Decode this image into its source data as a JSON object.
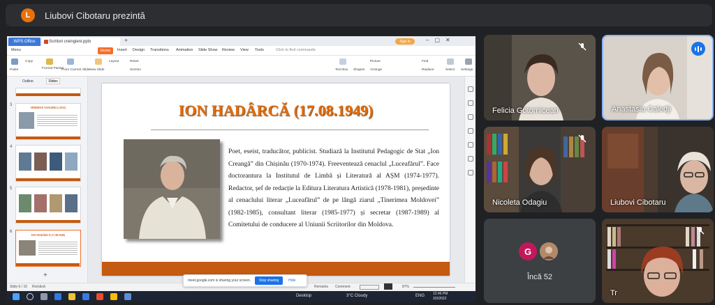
{
  "presenter": {
    "avatar_initial": "L",
    "label": "Liubovi Cibotaru prezintă"
  },
  "wps": {
    "office_tab": "WPS Office",
    "file_tab": "Scriitori creingieni.pptx",
    "sign_in": "Sign in",
    "menu": [
      "Menu",
      "Home",
      "Insert",
      "Design",
      "Transitions",
      "Animation",
      "Slide Show",
      "Review",
      "View",
      "Tools",
      "Click to find commands"
    ],
    "ribbon": [
      "Paste",
      "Copy",
      "Format Painter",
      "From Current Slide",
      "New Slide",
      "Layout",
      "Reset",
      "Section",
      "Text Box",
      "Shapes",
      "Picture",
      "Arrange",
      "Find",
      "Replace",
      "Select",
      "Settings"
    ],
    "pane_tabs": [
      "Outline",
      "Slides"
    ],
    "thumbs": [
      {
        "num": "3",
        "title": "SPIRIDON VANGHELI (1932)"
      },
      {
        "num": "4",
        "title": ""
      },
      {
        "num": "5",
        "title": ""
      },
      {
        "num": "6",
        "title": "ION HADÂRCĂ (17.08.1949)"
      }
    ],
    "status_left": "Slide 6 / 16",
    "status_lang": "Română",
    "status_right": [
      "Remarks",
      "Comment",
      "87%"
    ],
    "share_toast": {
      "text": "meet.google.com is sharing your screen.",
      "stop": "Stop sharing",
      "hide": "Hide"
    },
    "taskbar": {
      "desktop": "Desktop",
      "weather": "3°C  Cloudy",
      "lang": "ENG",
      "time": "12:45 PM",
      "date": "3/3/2022"
    }
  },
  "slide": {
    "title": "ION HADÂRCĂ (17.08.1949)",
    "body": "Poet, eseist, traducător, publicist. Studiază la Institutul Pedagogic de Stat „Ion Creangă” din Chișinău (1970-1974). Freeventează cenaclul „Luceafărul”. Face doctorantura la Institutul de Limbă și Literatură al AȘM (1974-1977). Redactor, șef de redacție la Editura Literatura Artistică (1978-1981), președinte al cenaclului literar „Luceafărul” de pe lângă ziarul „Tinerimea Moldovei” (1982-1985), consultant literar (1985-1977) și secretar (1987-1989) al Comitetului de conducere al Uniunii Scriitorilor din Moldova."
  },
  "participants": [
    {
      "name": "Felicia Gotornicean",
      "muted": true
    },
    {
      "name": "Anastasia Caledji",
      "muted": false,
      "speaking": true
    },
    {
      "name": "Nicoleta Odagiu",
      "muted": true
    },
    {
      "name": "Liubovi Cibotaru",
      "muted": false
    },
    {
      "name": "Încă 52",
      "extra_initial": "G"
    },
    {
      "name": "Tr",
      "muted": true
    }
  ],
  "colors": {
    "accent": "#f36f2b",
    "slide_title": "#e36c0a",
    "slide_bar": "#c55a11",
    "meet_bg": "#202124",
    "speaking": "#1a73e8"
  }
}
